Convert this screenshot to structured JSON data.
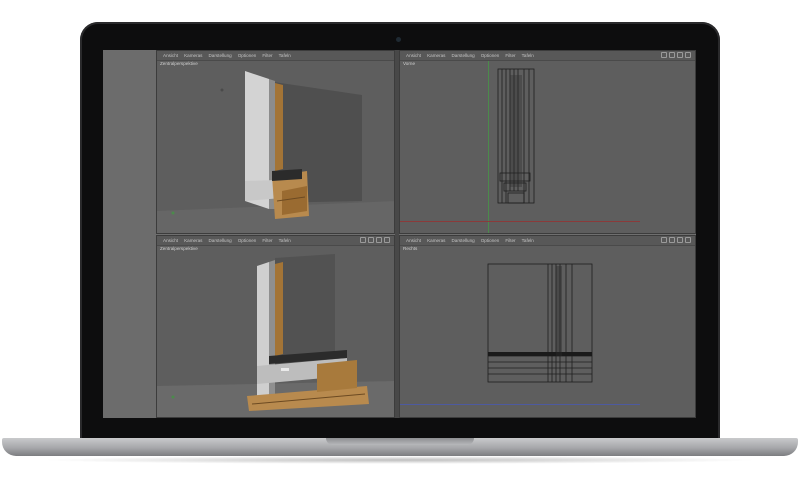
{
  "viewports": {
    "top_left": {
      "menu": [
        "Ansicht",
        "Kameras",
        "Darstellung",
        "Optionen",
        "Filter",
        "Tafeln"
      ],
      "name": "Zentralperspektive"
    },
    "top_right": {
      "menu": [
        "Ansicht",
        "Kameras",
        "Darstellung",
        "Optionen",
        "Filter",
        "Tafeln"
      ],
      "name": "Vorne"
    },
    "bottom_left": {
      "menu": [
        "Ansicht",
        "Kameras",
        "Darstellung",
        "Optionen",
        "Filter",
        "Tafeln"
      ],
      "name": "Zentralperspektive"
    },
    "bottom_right": {
      "menu": [
        "Ansicht",
        "Kameras",
        "Darstellung",
        "Optionen",
        "Filter",
        "Tafeln"
      ],
      "name": "Rechts"
    }
  },
  "colors": {
    "wood": "#b88a4e",
    "aluminium": "#c9c9c9",
    "frame_dark": "#2b2b2b"
  }
}
